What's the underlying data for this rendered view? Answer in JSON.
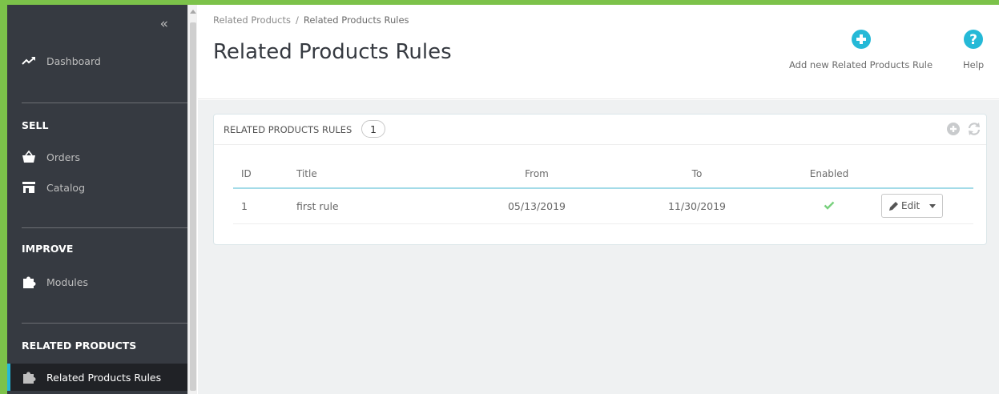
{
  "sidebar": {
    "collapse_glyph": "«",
    "dashboard": {
      "label": "Dashboard",
      "icon": "trending-up-icon"
    },
    "sections": [
      {
        "title": "SELL",
        "items": [
          {
            "label": "Orders",
            "icon": "shopping-basket-icon"
          },
          {
            "label": "Catalog",
            "icon": "store-icon"
          }
        ]
      },
      {
        "title": "IMPROVE",
        "items": [
          {
            "label": "Modules",
            "icon": "puzzle-icon"
          }
        ]
      },
      {
        "title": "RELATED PRODUCTS",
        "items": [
          {
            "label": "Related Products Rules",
            "icon": "puzzle-icon",
            "active": true
          }
        ]
      }
    ]
  },
  "header": {
    "breadcrumb": {
      "parent": "Related Products",
      "separator": "/",
      "current": "Related Products Rules"
    },
    "title": "Related Products Rules",
    "toolbar": {
      "add_label": "Add new Related Products Rule",
      "help_label": "Help"
    }
  },
  "panel": {
    "title": "RELATED PRODUCTS RULES",
    "count": "1",
    "columns": {
      "id": "ID",
      "title": "Title",
      "from": "From",
      "to": "To",
      "enabled": "Enabled"
    },
    "rows": [
      {
        "id": "1",
        "title": "first rule",
        "from": "05/13/2019",
        "to": "11/30/2019",
        "enabled": true
      }
    ],
    "edit_label": "Edit"
  },
  "colors": {
    "accent": "#25b9d7",
    "sidebar_bg": "#363a41",
    "frame": "#7cc24a",
    "enabled_check": "#78d07d"
  }
}
